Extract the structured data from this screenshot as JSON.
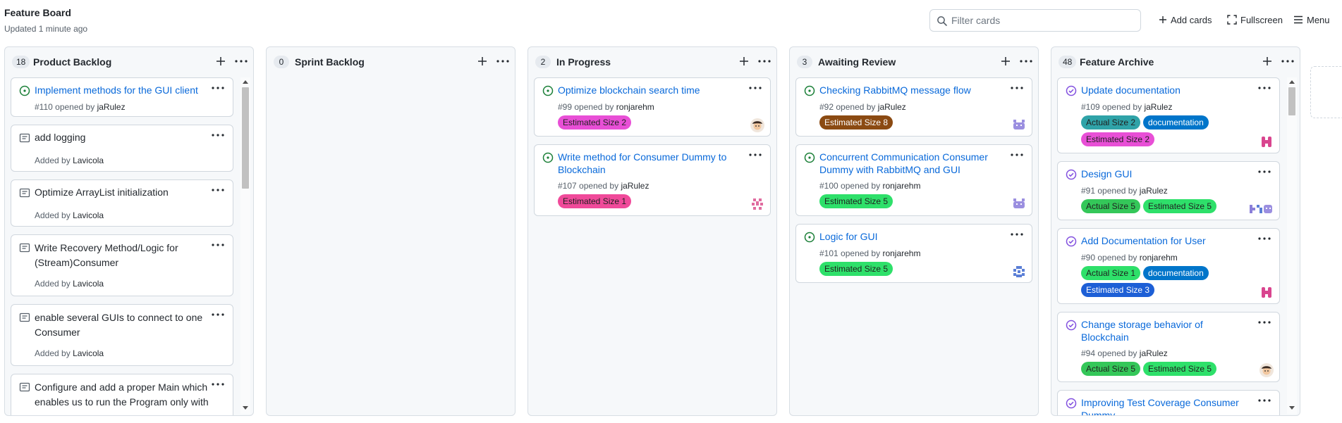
{
  "board": {
    "title": "Feature Board",
    "updated": "Updated 1 minute ago"
  },
  "toolbar": {
    "filter_placeholder": "Filter cards",
    "add_cards": "Add cards",
    "fullscreen": "Fullscreen",
    "menu": "Menu"
  },
  "colors": {
    "open": "#1a7f37",
    "closed": "#8250df",
    "link": "#0969da"
  },
  "columns": [
    {
      "count": "18",
      "name": "Product Backlog",
      "cards": [
        {
          "title": "Implement methods for the GUI client",
          "number": "#110",
          "opened_by": "opened by",
          "author": "jaRulez",
          "icon": "open-issue-icon"
        },
        {
          "title": "add logging",
          "added_by": "Added by",
          "author": "Lavicola",
          "icon": "note-icon"
        },
        {
          "title": "Optimize ArrayList initialization",
          "added_by": "Added by",
          "author": "Lavicola",
          "icon": "note-icon"
        },
        {
          "title": "Write Recovery Method/Logic for (Stream)Consumer",
          "added_by": "Added by",
          "author": "Lavicola",
          "icon": "note-icon"
        },
        {
          "title": "enable several GUIs to connect to one Consumer",
          "added_by": "Added by",
          "author": "Lavicola",
          "icon": "note-icon"
        },
        {
          "title": "Configure and add a proper Main which enables us to run the Program only with",
          "icon": "note-icon"
        }
      ]
    },
    {
      "count": "0",
      "name": "Sprint Backlog",
      "cards": []
    },
    {
      "count": "2",
      "name": "In Progress",
      "cards": [
        {
          "title": "Optimize blockchain search time",
          "number": "#99",
          "opened_by": "opened by",
          "author": "ronjarehm",
          "labels": [
            {
              "text": "Estimated Size 2",
              "bg": "#e84fd6",
              "fg": "#1f1f1f"
            }
          ],
          "avatar": "avatar-person"
        },
        {
          "title": "Write method for Consumer Dummy to Blockchain",
          "number": "#107",
          "opened_by": "opened by",
          "author": "jaRulez",
          "labels": [
            {
              "text": "Estimated Size 1",
              "bg": "#f04a9a",
              "fg": "#1f1f1f"
            }
          ],
          "avatar": "avatar-pink"
        }
      ]
    },
    {
      "count": "3",
      "name": "Awaiting Review",
      "cards": [
        {
          "title": "Checking RabbitMQ message flow",
          "number": "#92",
          "opened_by": "opened by",
          "author": "jaRulez",
          "labels": [
            {
              "text": "Estimated Size 8",
              "bg": "#8b4a12",
              "fg": "#ffffff"
            }
          ],
          "avatar": "avatar-purple"
        },
        {
          "title": "Concurrent Communication Consumer Dummy with RabbitMQ and GUI",
          "number": "#100",
          "opened_by": "opened by",
          "author": "ronjarehm",
          "labels": [
            {
              "text": "Estimated Size 5",
              "bg": "#2ee06a",
              "fg": "#1f1f1f"
            }
          ],
          "avatar": "avatar-purple"
        },
        {
          "title": "Logic for GUI",
          "number": "#101",
          "opened_by": "opened by",
          "author": "ronjarehm",
          "labels": [
            {
              "text": "Estimated Size 5",
              "bg": "#2ee06a",
              "fg": "#1f1f1f"
            }
          ],
          "avatar": "avatar-blue"
        }
      ]
    },
    {
      "count": "48",
      "name": "Feature Archive",
      "cards": [
        {
          "title": "Update documentation",
          "number": "#109",
          "opened_by": "opened by",
          "author": "jaRulez",
          "labels": [
            {
              "text": "Actual Size 2",
              "bg": "#2fa3a8",
              "fg": "#1f1f1f"
            },
            {
              "text": "documentation",
              "bg": "#0075ca",
              "fg": "#ffffff"
            },
            {
              "text": "Estimated Size 2",
              "bg": "#e84fd6",
              "fg": "#1f1f1f"
            }
          ],
          "avatar": "avatar-magenta"
        },
        {
          "title": "Design GUI",
          "number": "#91",
          "opened_by": "opened by",
          "author": "jaRulez",
          "labels": [
            {
              "text": "Actual Size 5",
              "bg": "#34c759",
              "fg": "#1f1f1f"
            },
            {
              "text": "Estimated Size 5",
              "bg": "#2ee06a",
              "fg": "#1f1f1f"
            }
          ],
          "avatar": "avatar-multi"
        },
        {
          "title": "Add Documentation for User",
          "number": "#90",
          "opened_by": "opened by",
          "author": "ronjarehm",
          "labels": [
            {
              "text": "Actual Size 1",
              "bg": "#2ee06a",
              "fg": "#1f1f1f"
            },
            {
              "text": "documentation",
              "bg": "#0075ca",
              "fg": "#ffffff"
            },
            {
              "text": "Estimated Size 3",
              "bg": "#1d5fd6",
              "fg": "#ffffff"
            }
          ],
          "avatar": "avatar-magenta"
        },
        {
          "title": "Change storage behavior of Blockchain",
          "number": "#94",
          "opened_by": "opened by",
          "author": "jaRulez",
          "labels": [
            {
              "text": "Actual Size 5",
              "bg": "#34c759",
              "fg": "#1f1f1f"
            },
            {
              "text": "Estimated Size 5",
              "bg": "#2ee06a",
              "fg": "#1f1f1f"
            }
          ],
          "avatar": "avatar-person"
        },
        {
          "title": "Improving Test Coverage Consumer Dummy"
        }
      ]
    }
  ]
}
